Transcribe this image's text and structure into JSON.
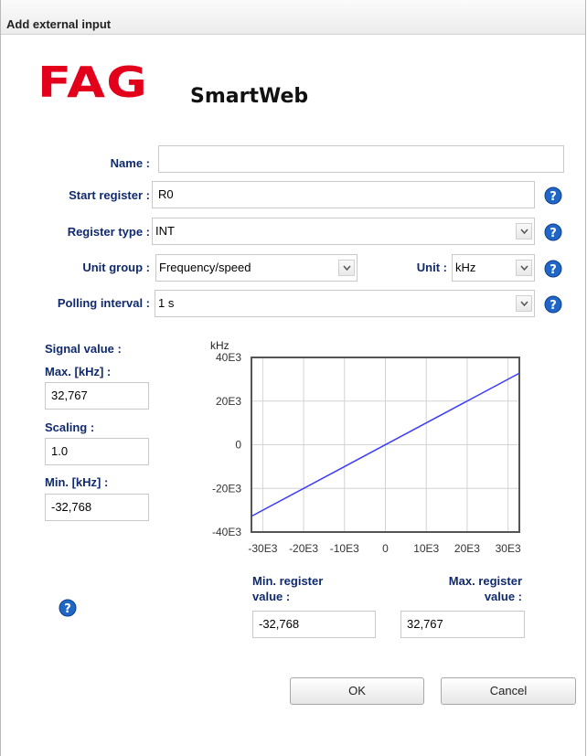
{
  "window": {
    "title": "Add external input"
  },
  "logo": {
    "brand": "FAG",
    "product": "SmartWeb"
  },
  "form": {
    "name_label": "Name :",
    "name_value": "",
    "start_register_label": "Start register :",
    "start_register_value": "R0",
    "register_type_label": "Register type :",
    "register_type_value": "INT",
    "unit_group_label": "Unit group :",
    "unit_group_value": "Frequency/speed",
    "unit_label": "Unit :",
    "unit_value": "kHz",
    "polling_interval_label": "Polling interval :",
    "polling_interval_value": "1 s"
  },
  "signal": {
    "title": "Signal value :",
    "max_label": "Max. [kHz] :",
    "max_value": "32,767",
    "scaling_label": "Scaling :",
    "scaling_value": "1.0",
    "min_label": "Min. [kHz] :",
    "min_value": "-32,768"
  },
  "register": {
    "min_label_1": "Min. register",
    "min_label_2": "value :",
    "min_value": "-32,768",
    "max_label_1": "Max. register",
    "max_label_2": "value :",
    "max_value": "32,767"
  },
  "buttons": {
    "ok": "OK",
    "cancel": "Cancel"
  },
  "chart_data": {
    "type": "line",
    "ylabel": "kHz",
    "xlim": [
      -32768,
      32767
    ],
    "ylim": [
      -40000,
      40000
    ],
    "x_ticks": [
      -30000,
      -20000,
      -10000,
      0,
      10000,
      20000,
      30000
    ],
    "x_tick_labels": [
      "-30E3",
      "-20E3",
      "-10E3",
      "0",
      "10E3",
      "20E3",
      "30E3"
    ],
    "y_ticks": [
      40000,
      20000,
      0,
      -20000,
      -40000
    ],
    "y_tick_labels": [
      "40E3",
      "20E3",
      "0",
      "-20E3",
      "-40E3"
    ],
    "grid": true,
    "series": [
      {
        "x": [
          -32768,
          32767
        ],
        "y": [
          -32768,
          32767
        ],
        "color": "#3b3bff"
      }
    ]
  },
  "colors": {
    "brand": "#e2001a",
    "label": "#102a6e",
    "help": "#1f66c7"
  }
}
